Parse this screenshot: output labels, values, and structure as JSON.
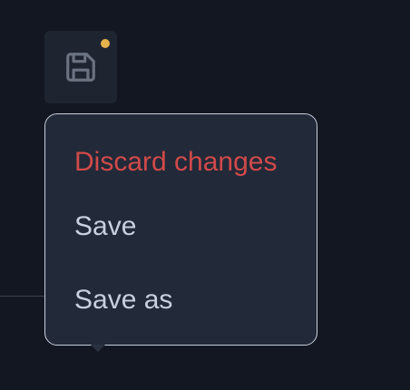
{
  "toolbar": {
    "save_icon": "floppy-disk-icon",
    "unsaved_indicator_color": "#e8b24a"
  },
  "menu": {
    "items": [
      {
        "label": "Discard changes",
        "color": "#d04a4a"
      },
      {
        "label": "Save",
        "color": "#c7d0de"
      },
      {
        "label": "Save as",
        "color": "#c7d0de"
      }
    ]
  }
}
